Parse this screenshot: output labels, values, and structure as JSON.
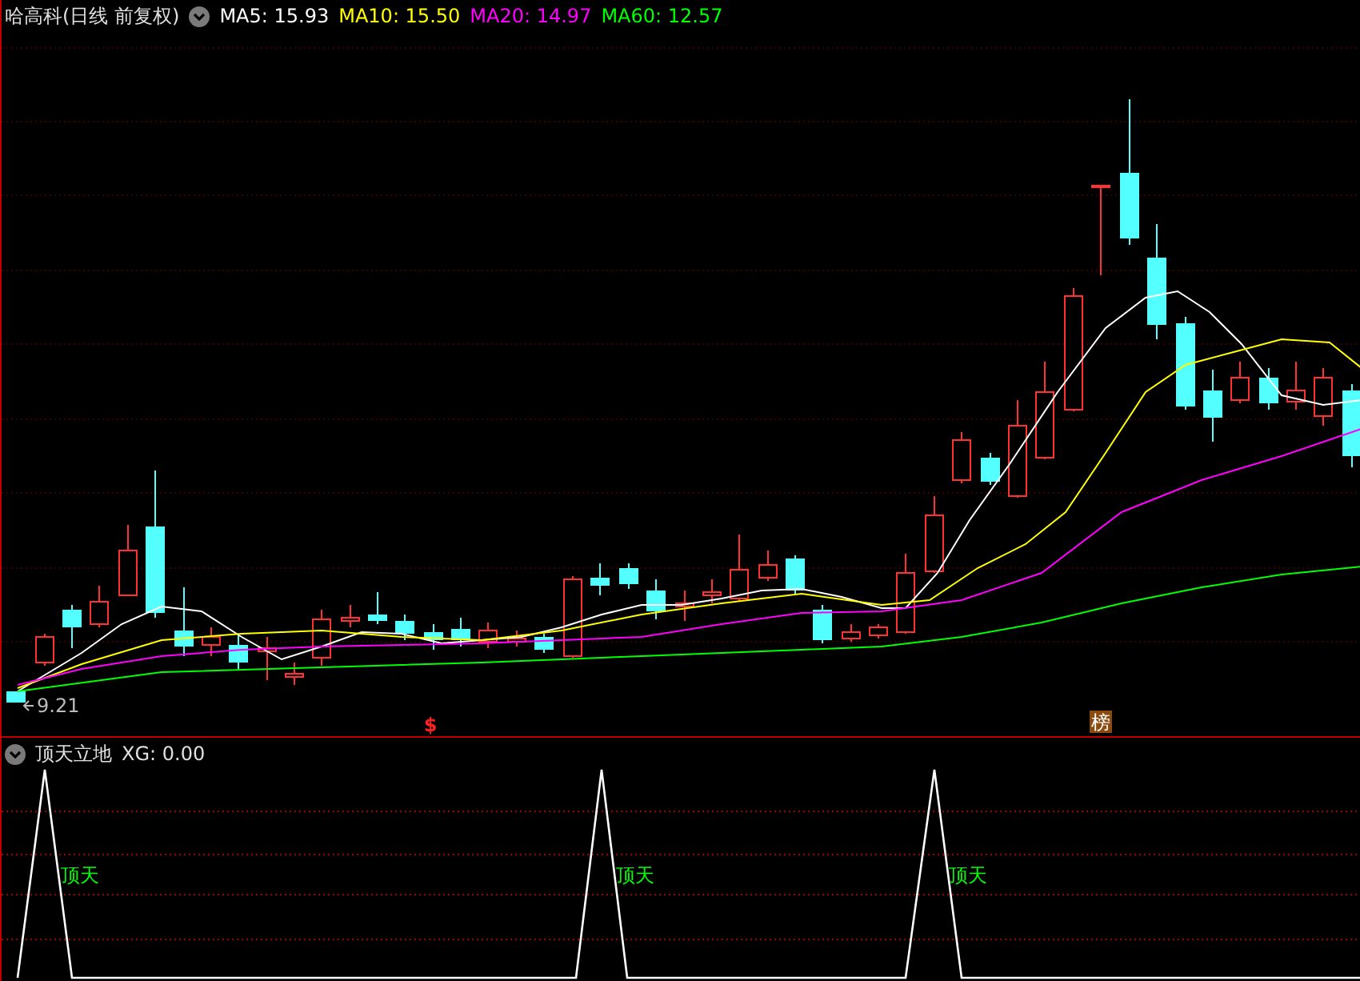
{
  "chart_header": {
    "title": "哈高科",
    "period": "(日线 前复权)",
    "indicators": [
      {
        "label": "MA5: 15.93",
        "color": "#ffffff"
      },
      {
        "label": "MA10: 15.50",
        "color": "#ffff00"
      },
      {
        "label": "MA20: 14.97",
        "color": "#ff00ff"
      },
      {
        "label": "MA60: 12.57",
        "color": "#00ff00"
      }
    ]
  },
  "price_chart": {
    "low_label": "9.21",
    "markers": [
      {
        "kind": "dollar",
        "text": "$"
      },
      {
        "kind": "badge",
        "text": "榜"
      }
    ]
  },
  "indicator_panel": {
    "title": "顶天立地",
    "value": "XG: 0.00",
    "signals": [
      "顶天",
      "顶天",
      "顶天"
    ]
  }
}
